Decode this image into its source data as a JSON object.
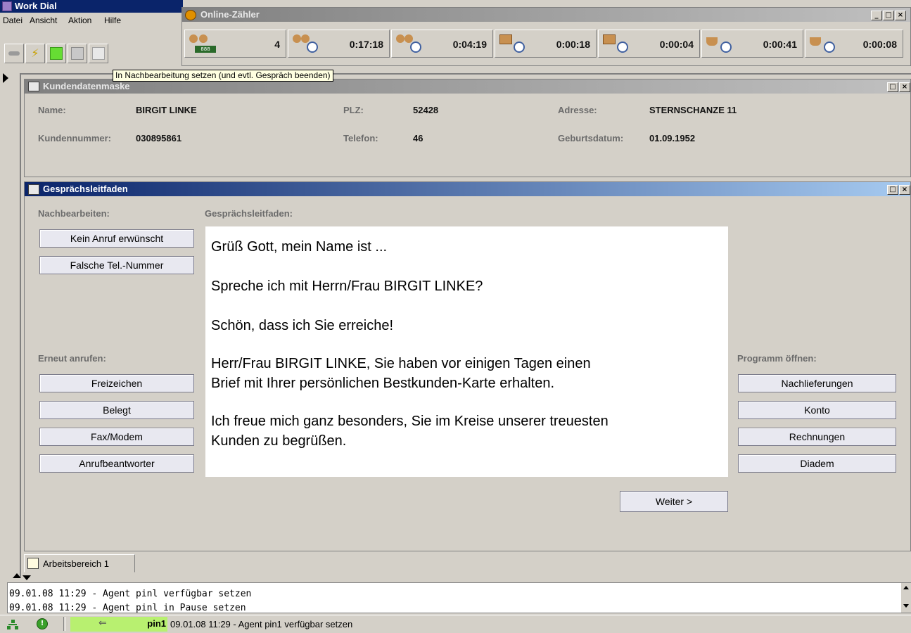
{
  "main_window": {
    "title": "Work Dial",
    "menu": [
      "Datei",
      "Ansicht",
      "Aktion",
      "Hilfe"
    ]
  },
  "counter_window": {
    "title": "Online-Zähler",
    "counters": [
      {
        "icon": "agents-waiting-icon",
        "value": "4"
      },
      {
        "icon": "agent-talk-timer-icon",
        "value": "0:17:18"
      },
      {
        "icon": "agents-timer-icon",
        "value": "0:04:19"
      },
      {
        "icon": "phone-timer-icon",
        "value": "0:00:18"
      },
      {
        "icon": "phone-check-timer-icon",
        "value": "0:00:04"
      },
      {
        "icon": "pause-cup-timer-icon",
        "value": "0:00:41"
      },
      {
        "icon": "cup-timer-icon",
        "value": "0:00:08"
      }
    ]
  },
  "tooltip": "In Nachbearbeitung setzen (und evtl. Gespräch beenden)",
  "customer": {
    "title": "Kundendatenmaske",
    "name_label": "Name:",
    "name_value": "BIRGIT LINKE",
    "plz_label": "PLZ:",
    "plz_value": "52428",
    "address_label": "Adresse:",
    "address_value": "STERNSCHANZE 11",
    "number_label": "Kundennummer:",
    "number_value": "030895861",
    "phone_label": "Telefon:",
    "phone_value": "46",
    "birth_label": "Geburtsdatum:",
    "birth_value": "01.09.1952"
  },
  "guide": {
    "title": "Gesprächsleitfaden",
    "left_heading": "Nachbearbeiten:",
    "center_heading": "Gesprächsleitfaden:",
    "post_buttons": [
      "Kein Anruf erwünscht",
      "Falsche Tel.-Nummer"
    ],
    "redial_heading": "Erneut anrufen:",
    "redial_buttons": [
      "Freizeichen",
      "Belegt",
      "Fax/Modem",
      "Anrufbeantworter"
    ],
    "program_heading": "Programm öffnen:",
    "program_buttons": [
      "Nachlieferungen",
      "Konto",
      "Rechnungen",
      "Diadem"
    ],
    "script": [
      "Grüß Gott, mein Name ist ...",
      "Spreche ich mit Herrn/Frau BIRGIT LINKE?",
      "Schön, dass ich Sie erreiche!",
      "Herr/Frau BIRGIT LINKE, Sie haben vor einigen Tagen einen",
      "Brief mit Ihrer persönlichen Bestkunden-Karte erhalten.",
      "Ich freue mich ganz besonders, Sie im Kreise unserer treuesten",
      "Kunden zu begrüßen."
    ],
    "next_button": "Weiter >"
  },
  "workspace_tab": "Arbeitsbereich 1",
  "log": [
    "09.01.08 11:29 - Agent pinl verfügbar setzen",
    "09.01.08 11:29 - Agent pinl in Pause setzen"
  ],
  "status": {
    "agent": "pin1",
    "message": "09.01.08 11:29 - Agent pin1 verfügbar setzen"
  }
}
